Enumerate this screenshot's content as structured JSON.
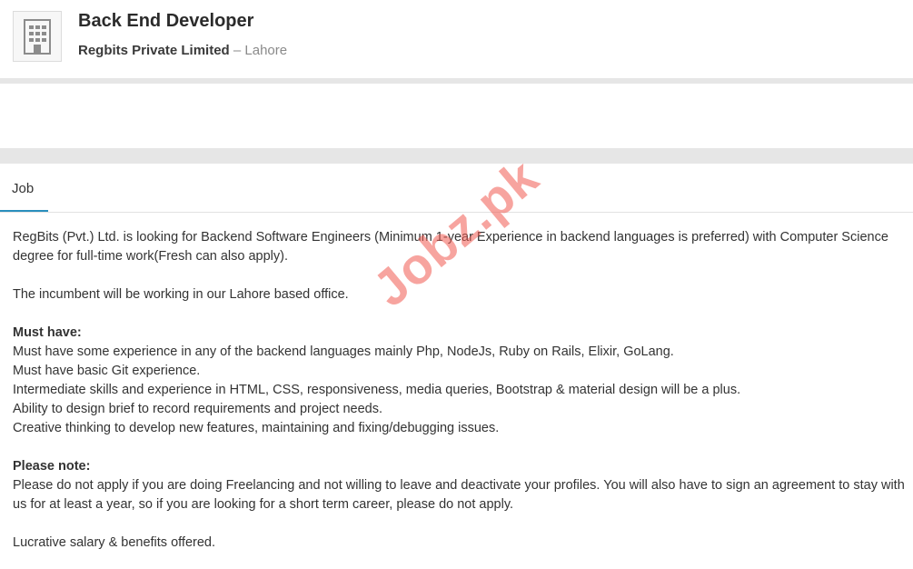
{
  "header": {
    "title": "Back End Developer",
    "company": "Regbits Private Limited",
    "separator": " – ",
    "location": "Lahore",
    "logo_icon": "building-icon"
  },
  "tabs": [
    {
      "label": "Job",
      "active": true
    }
  ],
  "description": {
    "intro": "RegBits (Pvt.) Ltd. is looking for Backend Software Engineers (Minimum 1-year Experience in backend languages is preferred) with Computer Science degree for full-time work(Fresh can also apply).",
    "office": "The incumbent will be working in our Lahore based office.",
    "must_have_heading": "Must have:",
    "must_have": [
      "Must have some experience in any of the backend languages mainly Php, NodeJs, Ruby on Rails, Elixir, GoLang.",
      "Must have basic Git experience.",
      "Intermediate skills and experience in HTML, CSS, responsiveness, media queries, Bootstrap & material design will be a plus.",
      "Ability to design brief to record requirements and project needs.",
      "Creative thinking to develop new features, maintaining and fixing/debugging issues."
    ],
    "note_heading": "Please note:",
    "note": "Please do not apply if you are doing Freelancing and not willing to leave and deactivate your profiles. You will also have to sign an agreement to stay with us for at least a year, so if you are looking for a short term career, please do not apply.",
    "closing": "Lucrative salary & benefits offered."
  },
  "watermark": "Jobz.pk",
  "colors": {
    "tab_active_underline": "#2a8fbd",
    "band": "#e6e6e6",
    "watermark": "#f05a50"
  }
}
